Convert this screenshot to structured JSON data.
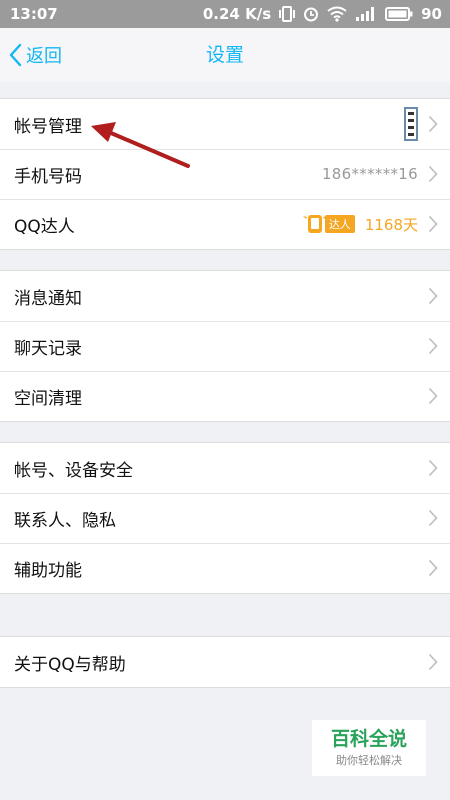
{
  "status_bar": {
    "time": "13:07",
    "net_speed": "0.24 K/s",
    "battery": "90"
  },
  "nav": {
    "back_label": "返回",
    "title": "设置"
  },
  "groups": [
    {
      "items": [
        {
          "label": "帐号管理",
          "value": "",
          "accessory": "qr-thumbnail"
        },
        {
          "label": "手机号码",
          "value": "186******16"
        },
        {
          "label": "QQ达人",
          "badge_text": "达人",
          "value": "1168天"
        }
      ]
    },
    {
      "items": [
        {
          "label": "消息通知"
        },
        {
          "label": "聊天记录"
        },
        {
          "label": "空间清理"
        }
      ]
    },
    {
      "items": [
        {
          "label": "帐号、设备安全"
        },
        {
          "label": "联系人、隐私"
        },
        {
          "label": "辅助功能"
        }
      ]
    },
    {
      "items": [
        {
          "label": "关于QQ与帮助"
        }
      ]
    }
  ],
  "watermark": {
    "main": "百科全说",
    "sub": "助你轻松解决"
  },
  "colors": {
    "accent": "#12b7f5",
    "annotation_arrow": "#b01e1e",
    "vip": "#f5a623",
    "watermark_green": "#2aa35a"
  }
}
